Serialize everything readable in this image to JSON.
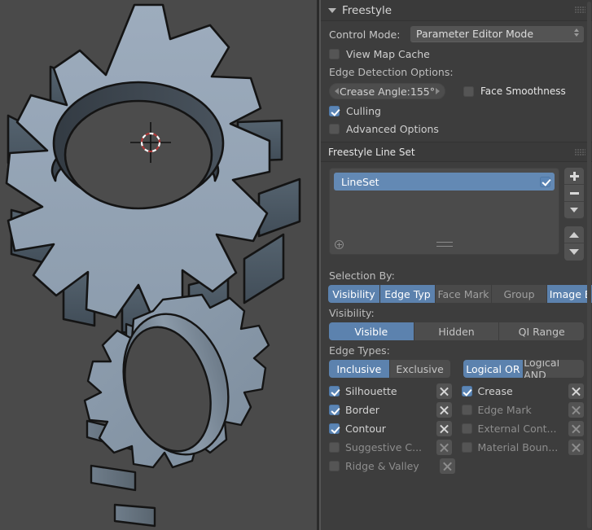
{
  "viewport": {
    "name": "3d-viewport",
    "background_color": "#4a4a4a",
    "object_fill": "#93a3b4",
    "object_shade_dark": "#4d5b6b",
    "object_outline": "#111111",
    "cursor": "3d-cursor"
  },
  "freestyle_panel": {
    "title": "Freestyle",
    "control_mode_label": "Control Mode:",
    "control_mode_value": "Parameter Editor Mode",
    "view_map_cache": {
      "label": "View Map Cache",
      "checked": false
    },
    "edge_detection_label": "Edge Detection Options:",
    "crease_angle": {
      "label": "Crease Angle:155°"
    },
    "face_smoothness": {
      "label": "Face Smoothness",
      "checked": false
    },
    "culling": {
      "label": "Culling",
      "checked": true
    },
    "advanced_options": {
      "label": "Advanced Options",
      "checked": false
    }
  },
  "lineset_panel": {
    "title": "Freestyle Line Set",
    "items": [
      {
        "name": "LineSet",
        "enabled": true,
        "selected": true
      }
    ],
    "buttons": {
      "add": "+",
      "remove": "–",
      "specials": "specials-dropdown",
      "move_up": "move-up",
      "move_down": "move-down"
    }
  },
  "selection": {
    "selection_by_label": "Selection By:",
    "tabs": [
      {
        "label": "Visibility",
        "active": true
      },
      {
        "label": "Edge Typ",
        "active": true
      },
      {
        "label": "Face Mark",
        "active": false
      },
      {
        "label": "Group",
        "active": false
      },
      {
        "label": "Image Bor",
        "active": true
      }
    ],
    "visibility_label": "Visibility:",
    "visibility_options": [
      {
        "label": "Visible",
        "active": true
      },
      {
        "label": "Hidden",
        "active": false
      },
      {
        "label": "QI Range",
        "active": false
      }
    ],
    "edge_types_label": "Edge Types:",
    "inclusive_options": [
      {
        "label": "Inclusive",
        "active": true
      },
      {
        "label": "Exclusive",
        "active": false
      }
    ],
    "logic_options": [
      {
        "label": "Logical OR",
        "active": true
      },
      {
        "label": "Logical AND",
        "active": false
      }
    ],
    "edge_types": [
      {
        "left": {
          "label": "Silhouette",
          "checked": true
        },
        "right": {
          "label": "Crease",
          "checked": true
        }
      },
      {
        "left": {
          "label": "Border",
          "checked": true
        },
        "right": {
          "label": "Edge Mark",
          "checked": false
        }
      },
      {
        "left": {
          "label": "Contour",
          "checked": true
        },
        "right": {
          "label": "External Cont...",
          "checked": false
        }
      },
      {
        "left": {
          "label": "Suggestive C...",
          "checked": false
        },
        "right": {
          "label": "Material Boun...",
          "checked": false
        }
      },
      {
        "left": {
          "label": "Ridge & Valley",
          "checked": false
        },
        "right": null
      }
    ]
  },
  "colors": {
    "accent_blue": "#5c82ae",
    "panel_bg": "#3d3d3d",
    "header_bg": "#3a3a3a",
    "widget_bg": "#535353"
  }
}
